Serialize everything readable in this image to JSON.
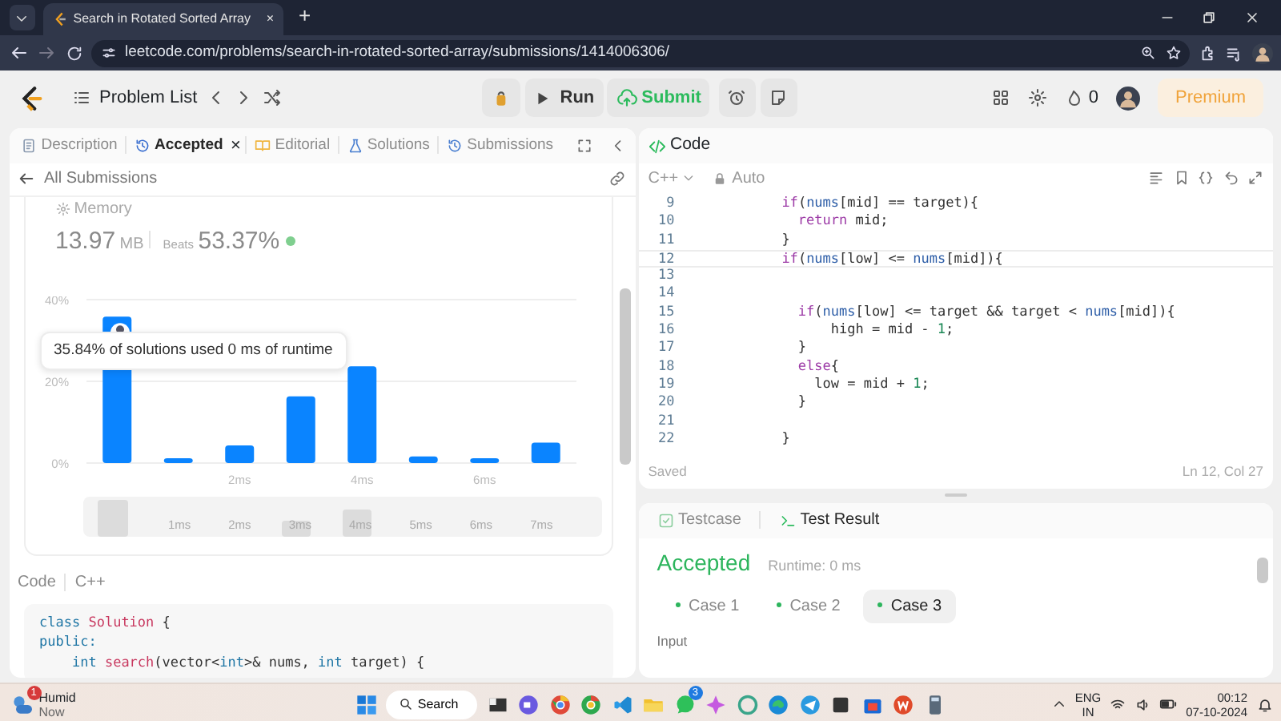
{
  "browser": {
    "tab_title": "Search in Rotated Sorted Array",
    "tab_close": "×",
    "new_tab": "+",
    "url": "leetcode.com/problems/search-in-rotated-sorted-array/submissions/1414006306/"
  },
  "header": {
    "problem_list": "Problem List",
    "run": "Run",
    "submit": "Submit",
    "streak": "0",
    "premium": "Premium"
  },
  "left_tabs": [
    {
      "label": "Description",
      "selected": false
    },
    {
      "label": "Accepted",
      "selected": true,
      "close": "×"
    },
    {
      "label": "Editorial",
      "selected": false
    },
    {
      "label": "Solutions",
      "selected": false
    },
    {
      "label": "Submissions",
      "selected": false
    }
  ],
  "submission": {
    "back": "All Submissions",
    "memory_label": "Memory",
    "memory_value": "13.97",
    "memory_unit": "MB",
    "beats_label": "Beats",
    "beats_value": "53.37%",
    "tooltip": "35.84% of solutions used 0 ms of runtime",
    "chart_data": {
      "type": "bar",
      "x": [
        0,
        1,
        2,
        3,
        4,
        5,
        6,
        7
      ],
      "xlim": [
        -0.5,
        7.5
      ],
      "ylim": [
        0,
        40
      ],
      "xticks": [
        {
          "value": 2,
          "label": "2ms"
        },
        {
          "value": 4,
          "label": "4ms"
        },
        {
          "value": 6,
          "label": "6ms"
        }
      ],
      "yticks": [
        {
          "value": 0,
          "label": "0%"
        },
        {
          "value": 20,
          "label": "20%"
        },
        {
          "value": 40,
          "label": "40%"
        }
      ],
      "series": [
        {
          "color": "#0a84ff",
          "values": [
            35.84,
            1.2,
            4.3,
            16.3,
            23.7,
            1.6,
            1.2,
            5.0
          ]
        }
      ]
    },
    "overview_labels": [
      "1ms",
      "2ms",
      "3ms",
      "4ms",
      "5ms",
      "6ms",
      "7ms"
    ],
    "code_label": "Code",
    "language": "C++",
    "code_lines": [
      [
        {
          "kind": "kw",
          "text": "class "
        },
        {
          "kind": "fn",
          "text": "Solution"
        },
        {
          "kind": "p",
          "text": " {"
        }
      ],
      [
        {
          "kind": "kw",
          "text": "public:"
        }
      ],
      [
        {
          "kind": "kw",
          "text": "    int "
        },
        {
          "kind": "fn",
          "text": "search"
        },
        {
          "kind": "p",
          "text": "(vector<"
        },
        {
          "kind": "kw",
          "text": "int"
        },
        {
          "kind": "p",
          "text": ">& nums, "
        },
        {
          "kind": "kw",
          "text": "int"
        },
        {
          "kind": "p",
          "text": " target) {"
        }
      ]
    ]
  },
  "editor": {
    "title": "Code",
    "language": "C++",
    "mode": "Auto",
    "lines": [
      {
        "number": "9",
        "tokens": [
          {
            "kind": "kw",
            "text": "        if"
          },
          {
            "kind": "p",
            "text": "("
          },
          {
            "kind": "var",
            "text": "nums"
          },
          {
            "kind": "p",
            "text": "[mid] == target){"
          }
        ]
      },
      {
        "number": "10",
        "tokens": [
          {
            "kind": "kw",
            "text": "          return"
          },
          {
            "kind": "p",
            "text": " mid;"
          }
        ]
      },
      {
        "number": "11",
        "tokens": [
          {
            "kind": "p",
            "text": "        }"
          }
        ]
      },
      {
        "number": "12",
        "highlighted": true,
        "tokens": [
          {
            "kind": "kw",
            "text": "        if"
          },
          {
            "kind": "p",
            "text": "("
          },
          {
            "kind": "var",
            "text": "nums"
          },
          {
            "kind": "p",
            "text": "[low] <= "
          },
          {
            "kind": "var",
            "text": "nums"
          },
          {
            "kind": "p",
            "text": "[mid]){"
          }
        ]
      },
      {
        "number": "13"
      },
      {
        "number": "14"
      },
      {
        "number": "15",
        "tokens": [
          {
            "kind": "kw",
            "text": "          if"
          },
          {
            "kind": "p",
            "text": "("
          },
          {
            "kind": "var",
            "text": "nums"
          },
          {
            "kind": "p",
            "text": "[low] <= target && target < "
          },
          {
            "kind": "var",
            "text": "nums"
          },
          {
            "kind": "p",
            "text": "[mid]){"
          }
        ]
      },
      {
        "number": "16",
        "tokens": [
          {
            "kind": "p",
            "text": "              high = mid - "
          },
          {
            "kind": "num",
            "text": "1"
          },
          {
            "kind": "p",
            "text": ";"
          }
        ]
      },
      {
        "number": "17",
        "tokens": [
          {
            "kind": "p",
            "text": "          }"
          }
        ]
      },
      {
        "number": "18",
        "tokens": [
          {
            "kind": "kw",
            "text": "          else"
          },
          {
            "kind": "p",
            "text": "{"
          }
        ]
      },
      {
        "number": "19",
        "tokens": [
          {
            "kind": "p",
            "text": "            low = mid + "
          },
          {
            "kind": "num",
            "text": "1"
          },
          {
            "kind": "p",
            "text": ";"
          }
        ]
      },
      {
        "number": "20",
        "tokens": [
          {
            "kind": "p",
            "text": "          }"
          }
        ]
      },
      {
        "number": "21"
      },
      {
        "number": "22",
        "tokens": [
          {
            "kind": "p",
            "text": "        }"
          }
        ]
      }
    ],
    "status": "Saved",
    "cursor": "Ln 12, Col 27"
  },
  "result": {
    "tabs": [
      {
        "label": "Testcase",
        "selected": false
      },
      {
        "label": "Test Result",
        "selected": true
      }
    ],
    "verdict": "Accepted",
    "runtime": "Runtime: 0 ms",
    "cases": [
      {
        "label": "Case 1",
        "selected": false
      },
      {
        "label": "Case 2",
        "selected": false
      },
      {
        "label": "Case 3",
        "selected": true
      }
    ],
    "input_label": "Input"
  },
  "taskbar": {
    "weather_badge": "1",
    "weather_title": "Humid",
    "weather_subtitle": "Now",
    "search": "Search",
    "chat_badge": "3",
    "language": "ENG",
    "region": "IN",
    "time": "00:12",
    "date": "07-10-2024"
  }
}
